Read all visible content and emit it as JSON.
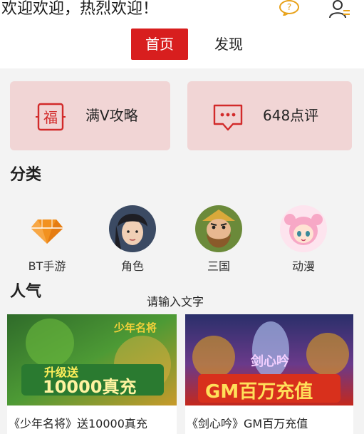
{
  "header": {
    "greeting": "欢迎欢迎，热烈欢迎！",
    "help_icon": "help-chat-icon",
    "user_icon": "user-icon"
  },
  "tabs": [
    {
      "label": "首页",
      "active": true
    },
    {
      "label": "发现",
      "active": false
    }
  ],
  "feature_cards": [
    {
      "label": "满V攻略",
      "icon": "ticket-icon"
    },
    {
      "label": "648点评",
      "icon": "comment-icon"
    }
  ],
  "categories": {
    "title": "分类",
    "items": [
      {
        "label": "BT手游",
        "icon": "diamond-icon"
      },
      {
        "label": "角色"
      },
      {
        "label": "三国"
      },
      {
        "label": "动漫"
      }
    ]
  },
  "popular": {
    "title": "人气",
    "search_hint": "请输入文字",
    "games": [
      {
        "title": "《少年名将》送10000真充",
        "banner_text": "10000真充",
        "banner_sub": "升级送",
        "logo": "少年名将"
      },
      {
        "title": "《剑心吟》GM百万充值",
        "banner_text": "GM百万充值",
        "logo": "剑心吟"
      }
    ]
  },
  "colors": {
    "accent": "#d81e1e",
    "card_bg": "#f1d5d5"
  }
}
